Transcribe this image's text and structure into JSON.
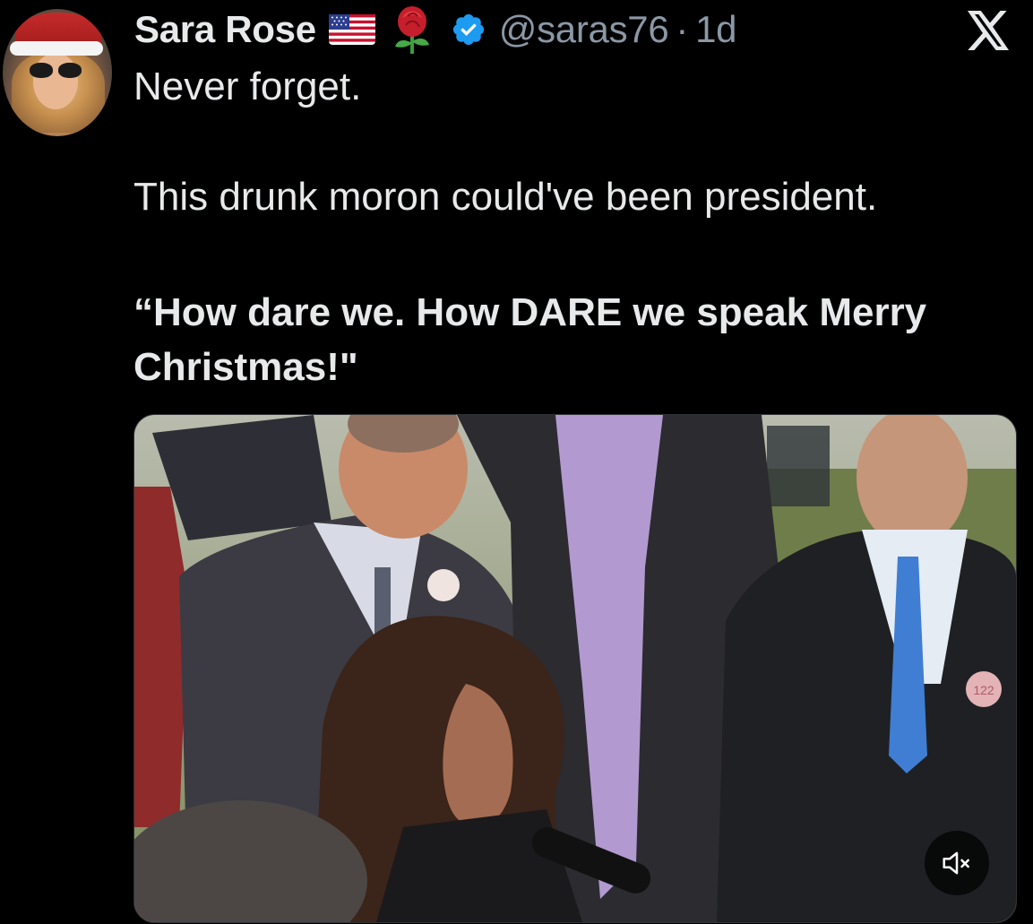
{
  "tweet": {
    "author": {
      "name": "Sara Rose",
      "handle": "@saras76",
      "separator": "·",
      "time": "1d",
      "badges": [
        "us-flag-emoji",
        "rose-emoji",
        "verified-badge-icon"
      ]
    },
    "body": {
      "line1": "Never forget.",
      "line2": "This drunk moron could've been president.",
      "quote": "“How dare we. How DARE we speak Merry Christmas!\""
    },
    "media": {
      "type": "video",
      "badge_text": "122",
      "audio_state": "muted",
      "control_icon": "speaker-muted-icon"
    },
    "platform_icon": "x-logo-icon"
  },
  "colors": {
    "background": "#000000",
    "text_primary": "#e7e9ea",
    "text_secondary": "#8b98a5",
    "verified_blue": "#1d9bf0"
  }
}
